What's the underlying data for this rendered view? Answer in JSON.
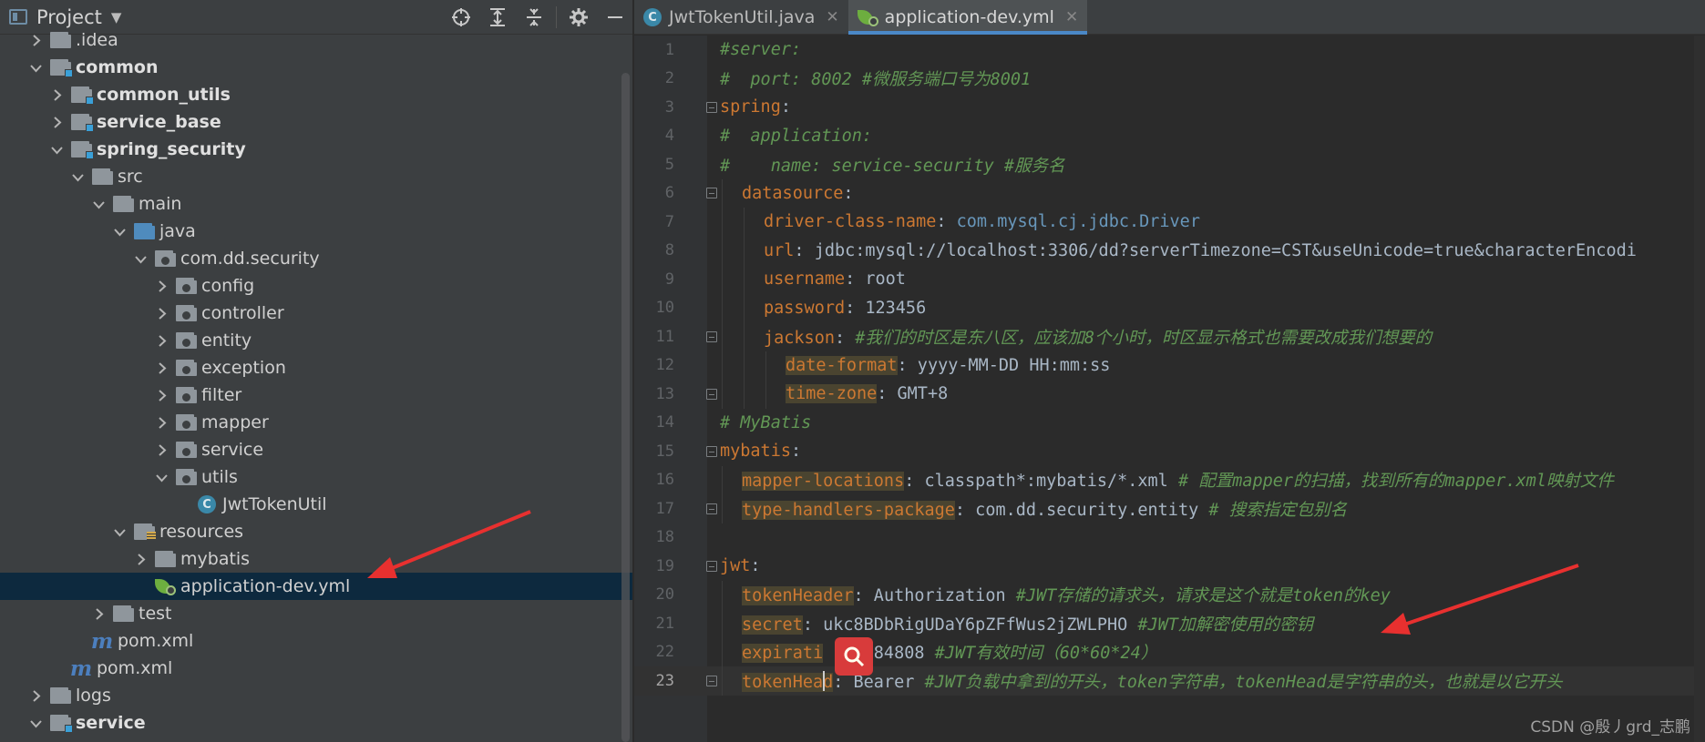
{
  "project_panel": {
    "title": "Project",
    "header_icons": [
      "locate-icon",
      "expand-all-icon",
      "collapse-all-icon",
      "gear-icon",
      "minimize-icon"
    ],
    "tree": [
      {
        "label": ".idea",
        "depth": 1,
        "arrow": "right",
        "icon": "folder",
        "bold": false
      },
      {
        "label": "common",
        "depth": 1,
        "arrow": "down",
        "icon": "module-folder",
        "bold": true
      },
      {
        "label": "common_utils",
        "depth": 2,
        "arrow": "right",
        "icon": "module-folder",
        "bold": true
      },
      {
        "label": "service_base",
        "depth": 2,
        "arrow": "right",
        "icon": "module-folder",
        "bold": true
      },
      {
        "label": "spring_security",
        "depth": 2,
        "arrow": "down",
        "icon": "module-folder",
        "bold": true
      },
      {
        "label": "src",
        "depth": 3,
        "arrow": "down",
        "icon": "folder",
        "bold": false
      },
      {
        "label": "main",
        "depth": 4,
        "arrow": "down",
        "icon": "folder",
        "bold": false
      },
      {
        "label": "java",
        "depth": 5,
        "arrow": "down",
        "icon": "source-folder",
        "bold": false
      },
      {
        "label": "com.dd.security",
        "depth": 6,
        "arrow": "down",
        "icon": "package-folder",
        "bold": false
      },
      {
        "label": "config",
        "depth": 7,
        "arrow": "right",
        "icon": "package-folder",
        "bold": false
      },
      {
        "label": "controller",
        "depth": 7,
        "arrow": "right",
        "icon": "package-folder",
        "bold": false
      },
      {
        "label": "entity",
        "depth": 7,
        "arrow": "right",
        "icon": "package-folder",
        "bold": false
      },
      {
        "label": "exception",
        "depth": 7,
        "arrow": "right",
        "icon": "package-folder",
        "bold": false
      },
      {
        "label": "filter",
        "depth": 7,
        "arrow": "right",
        "icon": "package-folder",
        "bold": false
      },
      {
        "label": "mapper",
        "depth": 7,
        "arrow": "right",
        "icon": "package-folder",
        "bold": false
      },
      {
        "label": "service",
        "depth": 7,
        "arrow": "right",
        "icon": "package-folder",
        "bold": false
      },
      {
        "label": "utils",
        "depth": 7,
        "arrow": "down",
        "icon": "package-folder",
        "bold": false
      },
      {
        "label": "JwtTokenUtil",
        "depth": 8,
        "arrow": "none",
        "icon": "java-class",
        "bold": false
      },
      {
        "label": "resources",
        "depth": 5,
        "arrow": "down",
        "icon": "resources-folder",
        "bold": false
      },
      {
        "label": "mybatis",
        "depth": 6,
        "arrow": "right",
        "icon": "folder",
        "bold": false
      },
      {
        "label": "application-dev.yml",
        "depth": 6,
        "arrow": "none",
        "icon": "yml-file",
        "bold": false,
        "selected": true
      },
      {
        "label": "test",
        "depth": 4,
        "arrow": "right",
        "icon": "folder",
        "bold": false
      },
      {
        "label": "pom.xml",
        "depth": 3,
        "arrow": "none",
        "icon": "maven-file",
        "bold": false
      },
      {
        "label": "pom.xml",
        "depth": 2,
        "arrow": "none",
        "icon": "maven-file",
        "bold": false
      },
      {
        "label": "logs",
        "depth": 1,
        "arrow": "right",
        "icon": "folder",
        "bold": false
      },
      {
        "label": "service",
        "depth": 1,
        "arrow": "down",
        "icon": "module-folder",
        "bold": true
      }
    ]
  },
  "editor": {
    "tabs": [
      {
        "label": "JwtTokenUtil.java",
        "icon": "java-class-icon",
        "active": false
      },
      {
        "label": "application-dev.yml",
        "icon": "yml-file-icon",
        "active": true
      }
    ],
    "current_line": 23,
    "lines": [
      {
        "n": "1",
        "indent": 0,
        "fold": "",
        "seg": [
          {
            "t": "#server:",
            "s": "c"
          }
        ]
      },
      {
        "n": "2",
        "indent": 0,
        "fold": "",
        "seg": [
          {
            "t": "#  port: 8002 #微服务端口号为8001",
            "s": "c"
          }
        ]
      },
      {
        "n": "3",
        "indent": 0,
        "fold": "start",
        "seg": [
          {
            "t": "spring",
            "s": "k"
          },
          {
            "t": ":",
            "s": "v"
          }
        ]
      },
      {
        "n": "4",
        "indent": 0,
        "fold": "",
        "seg": [
          {
            "t": "#  application:",
            "s": "c"
          }
        ]
      },
      {
        "n": "5",
        "indent": 0,
        "fold": "",
        "seg": [
          {
            "t": "#    name: service-security #服务名",
            "s": "c"
          }
        ]
      },
      {
        "n": "6",
        "indent": 1,
        "fold": "start",
        "seg": [
          {
            "t": "datasource",
            "s": "k"
          },
          {
            "t": ":",
            "s": "v"
          }
        ]
      },
      {
        "n": "7",
        "indent": 2,
        "fold": "",
        "seg": [
          {
            "t": "driver-class-name",
            "s": "k"
          },
          {
            "t": ": ",
            "s": "v"
          },
          {
            "t": "com.mysql.cj.jdbc.Driver",
            "s": "dv"
          }
        ]
      },
      {
        "n": "8",
        "indent": 2,
        "fold": "",
        "seg": [
          {
            "t": "url",
            "s": "k"
          },
          {
            "t": ": jdbc:mysql://localhost:3306/dd?serverTimezone=CST&useUnicode=true&characterEncodi",
            "s": "v"
          }
        ]
      },
      {
        "n": "9",
        "indent": 2,
        "fold": "",
        "seg": [
          {
            "t": "username",
            "s": "k"
          },
          {
            "t": ": root",
            "s": "v"
          }
        ]
      },
      {
        "n": "10",
        "indent": 2,
        "fold": "",
        "seg": [
          {
            "t": "password",
            "s": "k"
          },
          {
            "t": ": 123456",
            "s": "v"
          }
        ]
      },
      {
        "n": "11",
        "indent": 2,
        "fold": "start",
        "seg": [
          {
            "t": "jackson",
            "s": "k"
          },
          {
            "t": ": ",
            "s": "v"
          },
          {
            "t": "#我们的时区是东八区，应该加8个小时，时区显示格式也需要改成我们想要的",
            "s": "c"
          }
        ]
      },
      {
        "n": "12",
        "indent": 3,
        "fold": "",
        "seg": [
          {
            "t": "date-format",
            "s": "k hl"
          },
          {
            "t": ": yyyy-MM-DD HH:mm:ss",
            "s": "v"
          }
        ]
      },
      {
        "n": "13",
        "indent": 3,
        "fold": "end",
        "seg": [
          {
            "t": "time-zone",
            "s": "k hl"
          },
          {
            "t": ": GMT+8",
            "s": "v"
          }
        ]
      },
      {
        "n": "14",
        "indent": 0,
        "fold": "",
        "seg": [
          {
            "t": "# MyBatis",
            "s": "c"
          }
        ]
      },
      {
        "n": "15",
        "indent": 0,
        "fold": "start",
        "seg": [
          {
            "t": "mybatis",
            "s": "k"
          },
          {
            "t": ":",
            "s": "v"
          }
        ]
      },
      {
        "n": "16",
        "indent": 1,
        "fold": "",
        "seg": [
          {
            "t": "mapper-locations",
            "s": "k hl"
          },
          {
            "t": ": classpath*:mybatis/*.xml ",
            "s": "v"
          },
          {
            "t": "# 配置mapper的扫描，找到所有的mapper.xml映射文件",
            "s": "c"
          }
        ]
      },
      {
        "n": "17",
        "indent": 1,
        "fold": "end",
        "seg": [
          {
            "t": "type-handlers-package",
            "s": "k hl"
          },
          {
            "t": ": com.dd.security.entity ",
            "s": "v"
          },
          {
            "t": "# 搜索指定包别名",
            "s": "c"
          }
        ]
      },
      {
        "n": "18",
        "indent": 0,
        "fold": "",
        "seg": []
      },
      {
        "n": "19",
        "indent": 0,
        "fold": "start",
        "seg": [
          {
            "t": "jwt",
            "s": "k"
          },
          {
            "t": ":",
            "s": "v"
          }
        ]
      },
      {
        "n": "20",
        "indent": 1,
        "fold": "",
        "seg": [
          {
            "t": "tokenHeader",
            "s": "k hl"
          },
          {
            "t": ": Authorization ",
            "s": "v"
          },
          {
            "t": "#JWT存储的请求头，请求是这个就是token的key",
            "s": "c"
          }
        ]
      },
      {
        "n": "21",
        "indent": 1,
        "fold": "",
        "seg": [
          {
            "t": "secret",
            "s": "k hl"
          },
          {
            "t": ": ukc8BDbRigUDaY6pZFfWus2jZWLPHO ",
            "s": "v"
          },
          {
            "t": "#JWT加解密使用的密钥",
            "s": "c"
          }
        ]
      },
      {
        "n": "22",
        "indent": 1,
        "fold": "",
        "seg": [
          {
            "t": "expirati",
            "s": "k hl"
          },
          {
            "t": "    684808 ",
            "s": "v"
          },
          {
            "t": "#JWT有效时间（60*60*24）",
            "s": "c"
          }
        ]
      },
      {
        "n": "23",
        "indent": 1,
        "fold": "end",
        "seg": [
          {
            "t": "tokenHead",
            "s": "k hl"
          },
          {
            "t": ": Bearer ",
            "s": "v"
          },
          {
            "t": "#JWT负载中拿到的开头，token字符串，tokenHead是字符串的头，也就是以它开头",
            "s": "c"
          }
        ]
      }
    ]
  },
  "watermark": "CSDN @殷丿grd_志鹏",
  "colors": {
    "annotation_arrow": "#e8302f",
    "selection": "#0d293e",
    "keyword": "#cc7832",
    "comment": "#629755"
  }
}
